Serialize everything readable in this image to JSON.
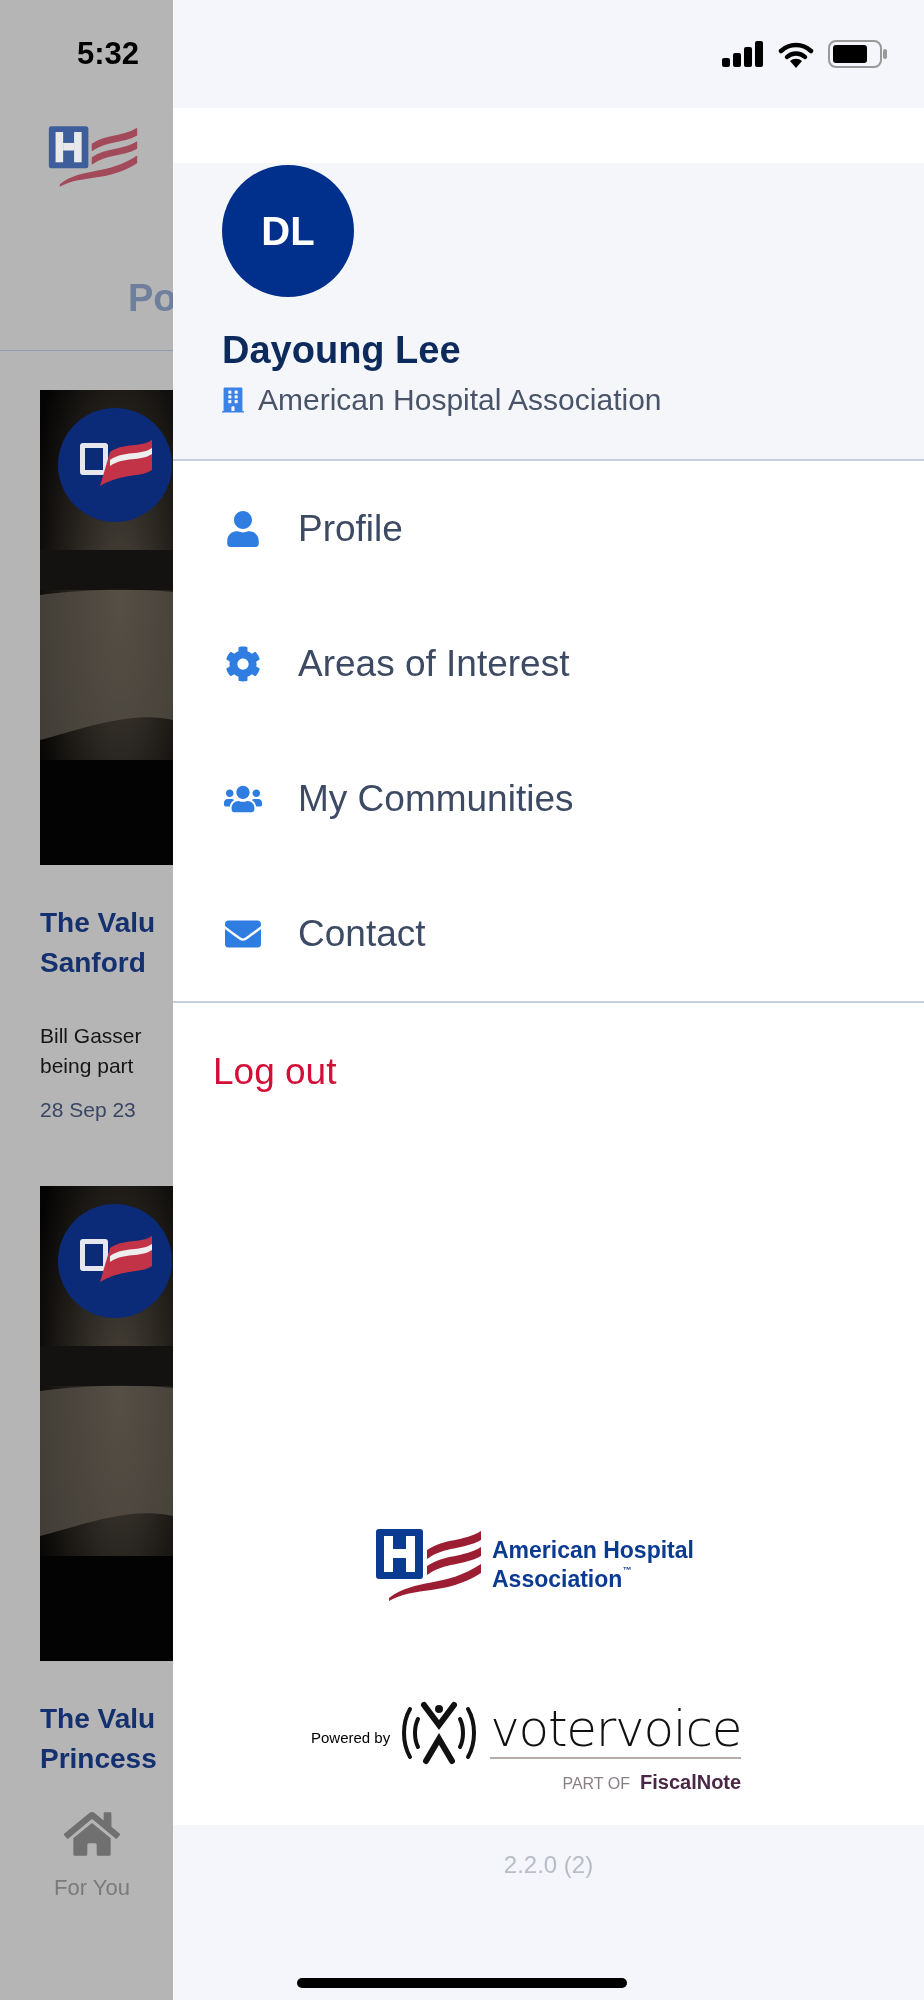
{
  "status_bar": {
    "time": "5:32"
  },
  "background": {
    "tab": "Po",
    "articles": [
      {
        "title_lines": [
          "The Valu",
          "Sanford"
        ],
        "summary_lines": [
          "Bill Gasser",
          "being part"
        ],
        "date": "28 Sep 23"
      },
      {
        "title_lines": [
          "The Valu",
          "Princess"
        ]
      }
    ],
    "tab_bar": [
      {
        "label": "For You"
      }
    ]
  },
  "drawer": {
    "user": {
      "initials": "DL",
      "name": "Dayoung Lee",
      "organization": "American Hospital Association"
    },
    "menu": [
      {
        "label": "Profile",
        "kind": "user"
      },
      {
        "label": "Areas of Interest",
        "kind": "gear"
      },
      {
        "label": "My Communities",
        "kind": "users"
      },
      {
        "label": "Contact",
        "kind": "envelope"
      }
    ],
    "logout": "Log out",
    "org_logo": {
      "lines": [
        "American Hospital",
        "Association"
      ],
      "mark": "™"
    },
    "powered_by": {
      "label": "Powered by",
      "brand": "votervoice",
      "part_of": "PART OF",
      "parent": "FiscalNote"
    },
    "version": "2.2.0 (2)"
  }
}
